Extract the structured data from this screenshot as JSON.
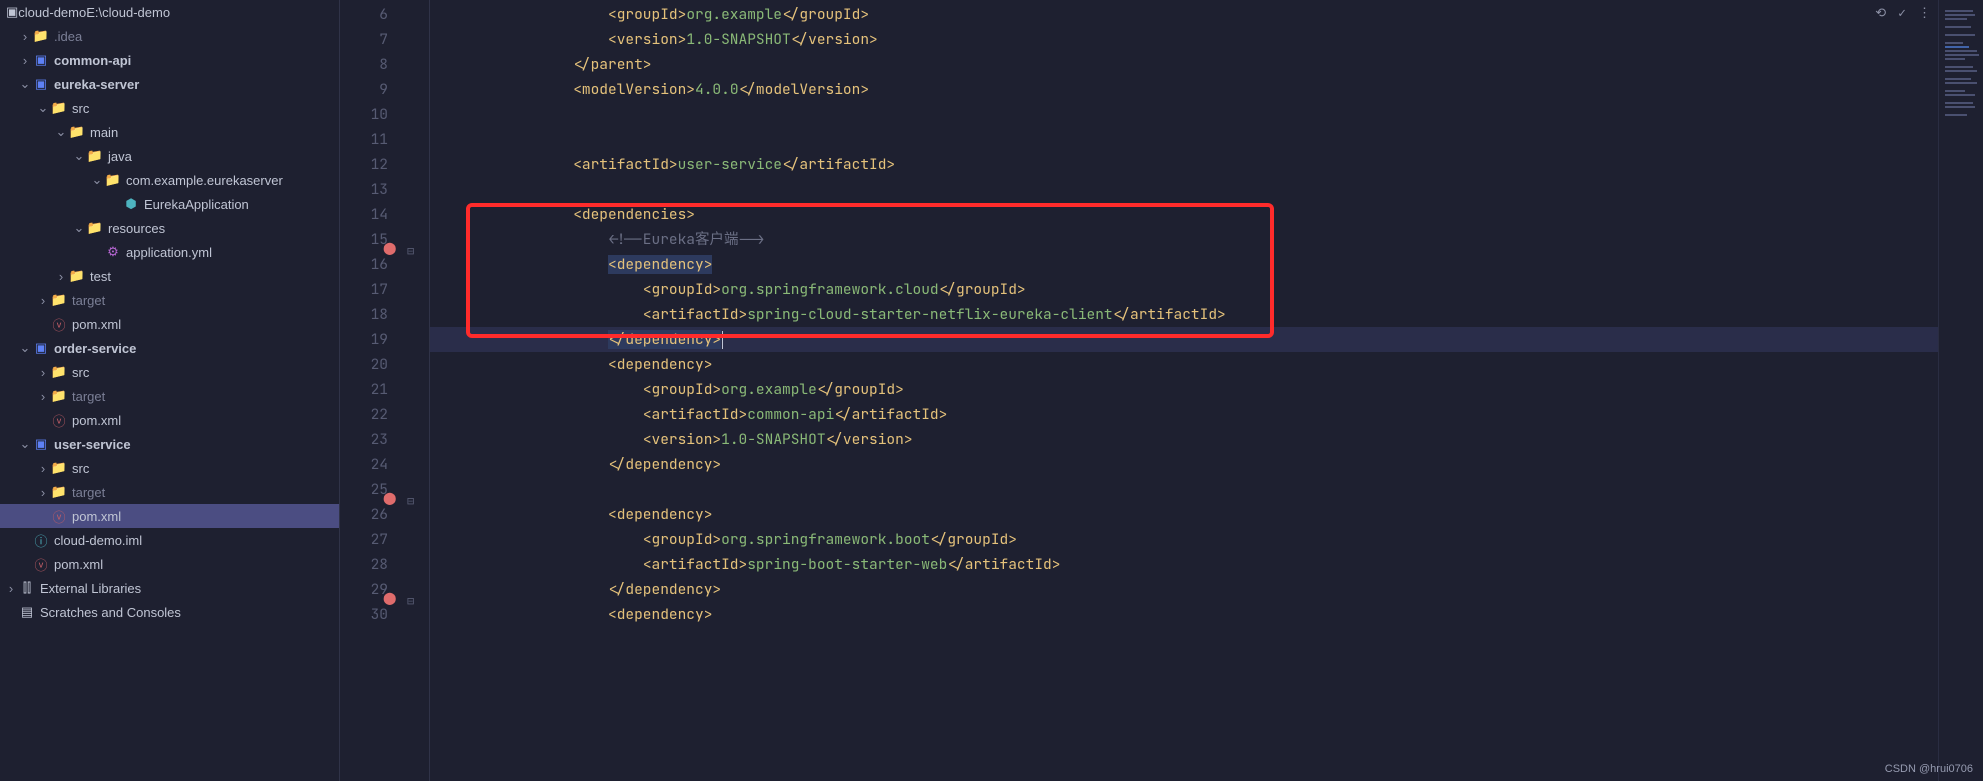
{
  "tree": {
    "root_name": "cloud-demo",
    "root_path": "E:\\cloud-demo",
    "idea": ".idea",
    "common_api": "common-api",
    "eureka_server": "eureka-server",
    "src": "src",
    "main": "main",
    "java": "java",
    "pkg": "com.example.eurekaserver",
    "eureka_app": "EurekaApplication",
    "resources": "resources",
    "app_yml": "application.yml",
    "test": "test",
    "target": "target",
    "pom": "pom.xml",
    "order_service": "order-service",
    "user_service": "user-service",
    "cloud_demo_iml": "cloud-demo.iml",
    "external_libs": "External Libraries",
    "scratches": "Scratches and Consoles"
  },
  "gutter_start": 6,
  "gutter_end": 30,
  "code": {
    "l6": {
      "i": 5,
      "segs": [
        {
          "t": "tag",
          "v": "<groupId>"
        },
        {
          "t": "text",
          "v": "org.example"
        },
        {
          "t": "tag",
          "v": "</groupId>"
        }
      ]
    },
    "l7": {
      "i": 5,
      "segs": [
        {
          "t": "tag",
          "v": "<version>"
        },
        {
          "t": "text",
          "v": "1.0-SNAPSHOT"
        },
        {
          "t": "tag",
          "v": "</version>"
        }
      ]
    },
    "l8": {
      "i": 4,
      "segs": [
        {
          "t": "tag",
          "v": "</parent>"
        }
      ]
    },
    "l9": {
      "i": 4,
      "segs": [
        {
          "t": "tag",
          "v": "<modelVersion>"
        },
        {
          "t": "text",
          "v": "4.0.0"
        },
        {
          "t": "tag",
          "v": "</modelVersion>"
        }
      ]
    },
    "l10": {
      "i": 0,
      "segs": []
    },
    "l11": {
      "i": 4,
      "segs": [
        {
          "t": "tag",
          "v": "<artifactId>"
        },
        {
          "t": "text",
          "v": "user-service"
        },
        {
          "t": "tag",
          "v": "</artifactId>"
        }
      ]
    },
    "l12": {
      "i": 0,
      "segs": []
    },
    "l13": {
      "i": 4,
      "segs": [
        {
          "t": "tag",
          "v": "<dependencies>"
        }
      ]
    },
    "l14": {
      "i": 5,
      "segs": [
        {
          "t": "cmt",
          "v": "<!--Eureka客户端-->"
        }
      ]
    },
    "l15": {
      "i": 5,
      "sel": true,
      "segs": [
        {
          "t": "tag",
          "v": "<dependency>"
        }
      ]
    },
    "l16": {
      "i": 6,
      "segs": [
        {
          "t": "tag",
          "v": "<groupId>"
        },
        {
          "t": "text",
          "v": "org.springframework.cloud"
        },
        {
          "t": "tag",
          "v": "</groupId>"
        }
      ]
    },
    "l17": {
      "i": 6,
      "segs": [
        {
          "t": "tag",
          "v": "<artifactId>"
        },
        {
          "t": "text",
          "v": "spring-cloud-starter-netflix-eureka-client"
        },
        {
          "t": "tag",
          "v": "</artifactId>"
        }
      ]
    },
    "l18": {
      "i": 5,
      "cur": true,
      "sel": true,
      "caret": true,
      "segs": [
        {
          "t": "tag",
          "v": "</dependency>"
        }
      ]
    },
    "l19": {
      "i": 5,
      "segs": [
        {
          "t": "tag",
          "v": "<dependency>"
        }
      ]
    },
    "l20": {
      "i": 6,
      "segs": [
        {
          "t": "tag",
          "v": "<groupId>"
        },
        {
          "t": "text",
          "v": "org.example"
        },
        {
          "t": "tag",
          "v": "</groupId>"
        }
      ]
    },
    "l21": {
      "i": 6,
      "segs": [
        {
          "t": "tag",
          "v": "<artifactId>"
        },
        {
          "t": "text",
          "v": "common-api"
        },
        {
          "t": "tag",
          "v": "</artifactId>"
        }
      ]
    },
    "l22": {
      "i": 6,
      "segs": [
        {
          "t": "tag",
          "v": "<version>"
        },
        {
          "t": "text",
          "v": "1.0-SNAPSHOT"
        },
        {
          "t": "tag",
          "v": "</version>"
        }
      ]
    },
    "l23": {
      "i": 5,
      "segs": [
        {
          "t": "tag",
          "v": "</dependency>"
        }
      ]
    },
    "l24": {
      "i": 0,
      "segs": []
    },
    "l25": {
      "i": 5,
      "segs": [
        {
          "t": "tag",
          "v": "<dependency>"
        }
      ]
    },
    "l26": {
      "i": 6,
      "segs": [
        {
          "t": "tag",
          "v": "<groupId>"
        },
        {
          "t": "text",
          "v": "org.springframework.boot"
        },
        {
          "t": "tag",
          "v": "</groupId>"
        }
      ]
    },
    "l27": {
      "i": 6,
      "segs": [
        {
          "t": "tag",
          "v": "<artifactId>"
        },
        {
          "t": "text",
          "v": "spring-boot-starter-web"
        },
        {
          "t": "tag",
          "v": "</artifactId>"
        }
      ]
    },
    "l28": {
      "i": 5,
      "segs": [
        {
          "t": "tag",
          "v": "</dependency>"
        }
      ]
    },
    "l29": {
      "i": 5,
      "segs": [
        {
          "t": "tag",
          "v": "<dependency>"
        }
      ]
    }
  },
  "watermark": "CSDN @hrui0706"
}
